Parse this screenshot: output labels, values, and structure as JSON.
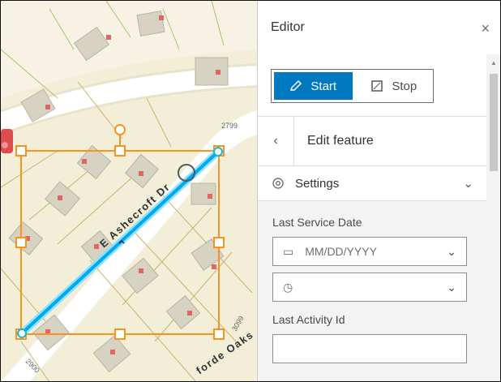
{
  "map": {
    "street_label": "E Ashecroft Dr",
    "street_label_2": "forde Oaks",
    "parcel_numbers": [
      "2799",
      "3099",
      "2900"
    ]
  },
  "panel": {
    "title": "Editor",
    "close_icon": "×",
    "start_label": "Start",
    "stop_label": "Stop",
    "edit_feature_title": "Edit feature",
    "settings_label": "Settings",
    "last_service_date_label": "Last Service Date",
    "date_placeholder": "MM/DD/YYYY",
    "time_value": "",
    "last_activity_id_label": "Last Activity Id",
    "last_activity_id_value": ""
  },
  "colors": {
    "accent": "#0079c1",
    "selection": "#f7931e",
    "line": "#00b0ff"
  }
}
